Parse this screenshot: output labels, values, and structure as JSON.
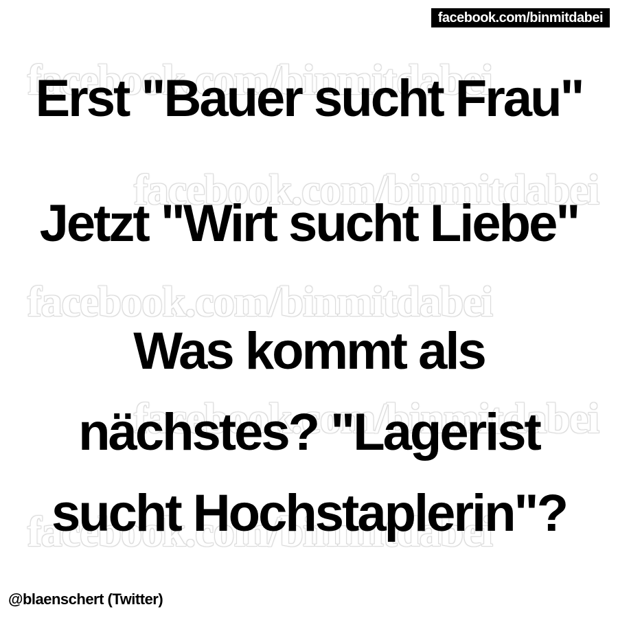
{
  "header": {
    "badge_text": "facebook.com/binmitdabei"
  },
  "watermark": {
    "text": "facebook.com/binmitdabei",
    "color": "#d0d0d0"
  },
  "content": {
    "lines": [
      "Erst \"Bauer sucht Frau\"",
      "Jetzt \"Wirt sucht Liebe\"",
      "Was kommt als",
      "nächstes? \"Lagerist",
      "sucht Hochstaplerin\"?"
    ]
  },
  "footer": {
    "credit": "@blaenschert (Twitter)"
  },
  "colors": {
    "background": "#ffffff",
    "text": "#000000",
    "badge_background": "#000000",
    "badge_text": "#ffffff"
  }
}
